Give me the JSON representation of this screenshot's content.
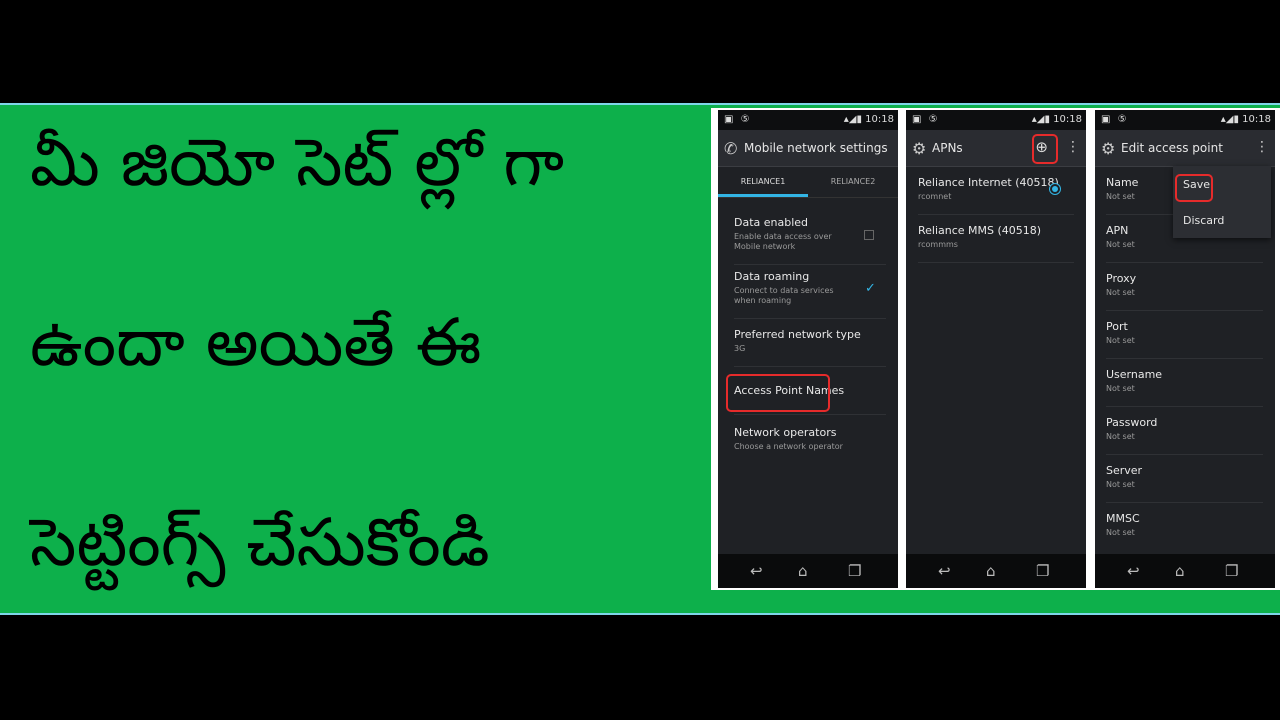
{
  "headline": {
    "line1": "మీ జియో సెట్ ల్లో గా",
    "line2": "ఉందా  అయితే ఈ",
    "line3": "సెట్టింగ్స్ చేసుకోండి"
  },
  "status_bar": {
    "time": "10:18"
  },
  "screen1": {
    "title": "Mobile network settings",
    "tabs": [
      "RELIANCE1",
      "RELIANCE2"
    ],
    "items": [
      {
        "title": "Data enabled",
        "summary": "Enable data access over Mobile network",
        "checked": false
      },
      {
        "title": "Data roaming",
        "summary": "Connect to data services when roaming",
        "checked": true
      },
      {
        "title": "Preferred network type",
        "summary": "3G"
      },
      {
        "title": "Access Point Names",
        "summary": ""
      },
      {
        "title": "Network operators",
        "summary": "Choose a network operator"
      }
    ]
  },
  "screen2": {
    "title": "APNs",
    "items": [
      {
        "title": "Reliance Internet (40518)",
        "summary": "rcomnet",
        "selected": true
      },
      {
        "title": "Reliance MMS (40518)",
        "summary": "rcommms",
        "selected": false
      }
    ]
  },
  "screen3": {
    "title": "Edit access point",
    "menu": [
      "Save",
      "Discard"
    ],
    "fields": [
      {
        "title": "Name",
        "summary": "Not set"
      },
      {
        "title": "APN",
        "summary": "Not set"
      },
      {
        "title": "Proxy",
        "summary": "Not set"
      },
      {
        "title": "Port",
        "summary": "Not set"
      },
      {
        "title": "Username",
        "summary": "Not set"
      },
      {
        "title": "Password",
        "summary": "Not set"
      },
      {
        "title": "Server",
        "summary": "Not set"
      },
      {
        "title": "MMSC",
        "summary": "Not set"
      }
    ]
  },
  "colors": {
    "banner": "#0db04b",
    "accent": "#33b5e5",
    "highlight": "#e62b2b"
  }
}
